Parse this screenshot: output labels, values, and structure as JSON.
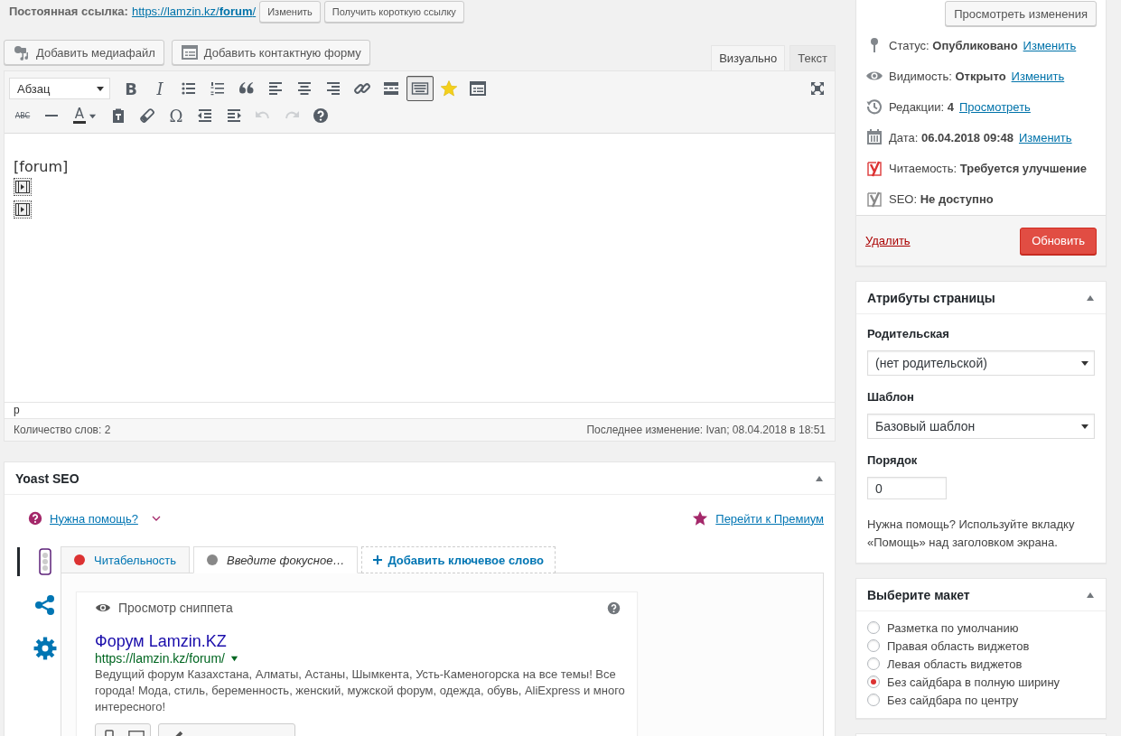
{
  "permalink": {
    "label": "Постоянная ссылка:",
    "url_base": "https://lamzin.kz/",
    "url_slug": "forum",
    "url_end": "/",
    "buttons": [
      "Изменить",
      "Получить короткую ссылку"
    ]
  },
  "media_buttons": [
    {
      "kind": "media",
      "label": "Добавить медиафайл"
    },
    {
      "kind": "form",
      "label": "Добавить контактную форму"
    }
  ],
  "editor_tabs": [
    {
      "label": "Визуально",
      "selected": true
    },
    {
      "label": "Текст",
      "selected": false
    }
  ],
  "format_select": "Абзац",
  "toolbar_rows": [
    [
      {
        "kind": "bold",
        "glyph": "B",
        "pressed": false,
        "disabled": false
      },
      {
        "kind": "italic",
        "glyph": "I",
        "pressed": false,
        "disabled": false
      },
      {
        "kind": "bullet-list",
        "pressed": false,
        "disabled": false
      },
      {
        "kind": "numbered-list",
        "pressed": false,
        "disabled": false
      },
      {
        "kind": "quote",
        "pressed": false,
        "disabled": false
      },
      {
        "kind": "align-left",
        "pressed": false,
        "disabled": false
      },
      {
        "kind": "align-center",
        "pressed": false,
        "disabled": false
      },
      {
        "kind": "align-right",
        "pressed": false,
        "disabled": false
      },
      {
        "kind": "link",
        "pressed": false,
        "disabled": false
      },
      {
        "kind": "read-more",
        "pressed": false,
        "disabled": false
      },
      {
        "kind": "keyboard",
        "pressed": true,
        "disabled": false
      },
      {
        "kind": "star",
        "pressed": false,
        "disabled": false
      },
      {
        "kind": "form",
        "pressed": false,
        "disabled": false
      }
    ],
    [
      {
        "kind": "strikethrough",
        "glyph": "ABC",
        "pressed": false,
        "disabled": false
      },
      {
        "kind": "horizontal-line",
        "pressed": false,
        "disabled": false
      },
      {
        "kind": "text-color",
        "glyph": "A",
        "pressed": false,
        "disabled": false
      },
      {
        "kind": "paste-text",
        "pressed": false,
        "disabled": false
      },
      {
        "kind": "eraser",
        "pressed": false,
        "disabled": false
      },
      {
        "kind": "special-character",
        "glyph": "Ω",
        "pressed": false,
        "disabled": false
      },
      {
        "kind": "outdent",
        "pressed": false,
        "disabled": false
      },
      {
        "kind": "indent",
        "pressed": false,
        "disabled": false
      },
      {
        "kind": "undo",
        "pressed": false,
        "disabled": true
      },
      {
        "kind": "redo",
        "pressed": false,
        "disabled": true
      },
      {
        "kind": "help",
        "pressed": false,
        "disabled": false
      }
    ]
  ],
  "content": [
    {
      "kind": "text",
      "text": "[forum]"
    },
    {
      "kind": "media-placeholder"
    },
    {
      "kind": "media-placeholder"
    }
  ],
  "path": "p",
  "word_count": "Количество слов: 2",
  "last_modified": "Последнее изменение: Ivan; 08.04.2018 в 18:51",
  "yoast": {
    "title": "Yoast SEO",
    "help_link": "Нужна помощь?",
    "premium_link": "Перейти к Премиум",
    "side_tabs": [
      {
        "kind": "traffic-light",
        "selected": true
      },
      {
        "kind": "share",
        "selected": false
      },
      {
        "kind": "gear",
        "selected": false
      }
    ],
    "tabs": [
      {
        "kind": "readability",
        "label": "Читабельность",
        "color": "#dc3232",
        "selected": false
      },
      {
        "kind": "keyphrase",
        "label": "Введите фокусное…",
        "color": "#888888",
        "selected": true
      }
    ],
    "add_keyword": "Добавить ключевое слово",
    "snippet": {
      "heading": "Просмотр сниппета",
      "title": "Форум Lamzin.KZ",
      "url": "https://lamzin.kz/forum/",
      "description": "Ведущий форум Казахстана, Алматы, Астаны, Шымкента, Усть-Каменогорска на все темы! Все города! Мода, стиль, беременность, женский, мужской форум, одежда, обувь, AliExpress и много интересного!",
      "modes": [
        {
          "kind": "mobile"
        },
        {
          "kind": "desktop"
        }
      ]
    }
  },
  "publish": {
    "preview_button": "Просмотреть изменения",
    "rows": [
      {
        "kind": "pin",
        "text": "Статус: **Опубликовано**",
        "link": "Изменить"
      },
      {
        "kind": "eye",
        "text": "Видимость: **Открыто**",
        "link": "Изменить"
      },
      {
        "kind": "history",
        "text": "Редакции: **4**",
        "link": "Просмотреть"
      },
      {
        "kind": "calendar",
        "text": "Дата: **06.04.2018 09:48**",
        "link": "Изменить"
      },
      {
        "kind": "score",
        "color": "#dc3232",
        "text": "Читаемость: **Требуется улучшение**"
      },
      {
        "kind": "score",
        "color": "#888888",
        "text": "SEO: **Не доступно**"
      }
    ],
    "delete_link": "Удалить",
    "update_button": "Обновить"
  },
  "page_attributes": {
    "title": "Атрибуты страницы",
    "parent_label": "Родительская",
    "parent_value": "(нет родительской)",
    "template_label": "Шаблон",
    "template_value": "Базовый шаблон",
    "order_label": "Порядок",
    "order_value": "0",
    "help": "Нужна помощь? Используйте вкладку «Помощь» над заголовком экрана."
  },
  "layout_box": {
    "title": "Выберите макет",
    "options": [
      {
        "label": "Разметка по умолчанию",
        "selected": false
      },
      {
        "label": "Правая область виджетов",
        "selected": false
      },
      {
        "label": "Левая область виджетов",
        "selected": false
      },
      {
        "label": "Без сайдбара в полную ширину",
        "selected": true
      },
      {
        "label": "Без сайдбара по центру",
        "selected": false
      }
    ]
  }
}
